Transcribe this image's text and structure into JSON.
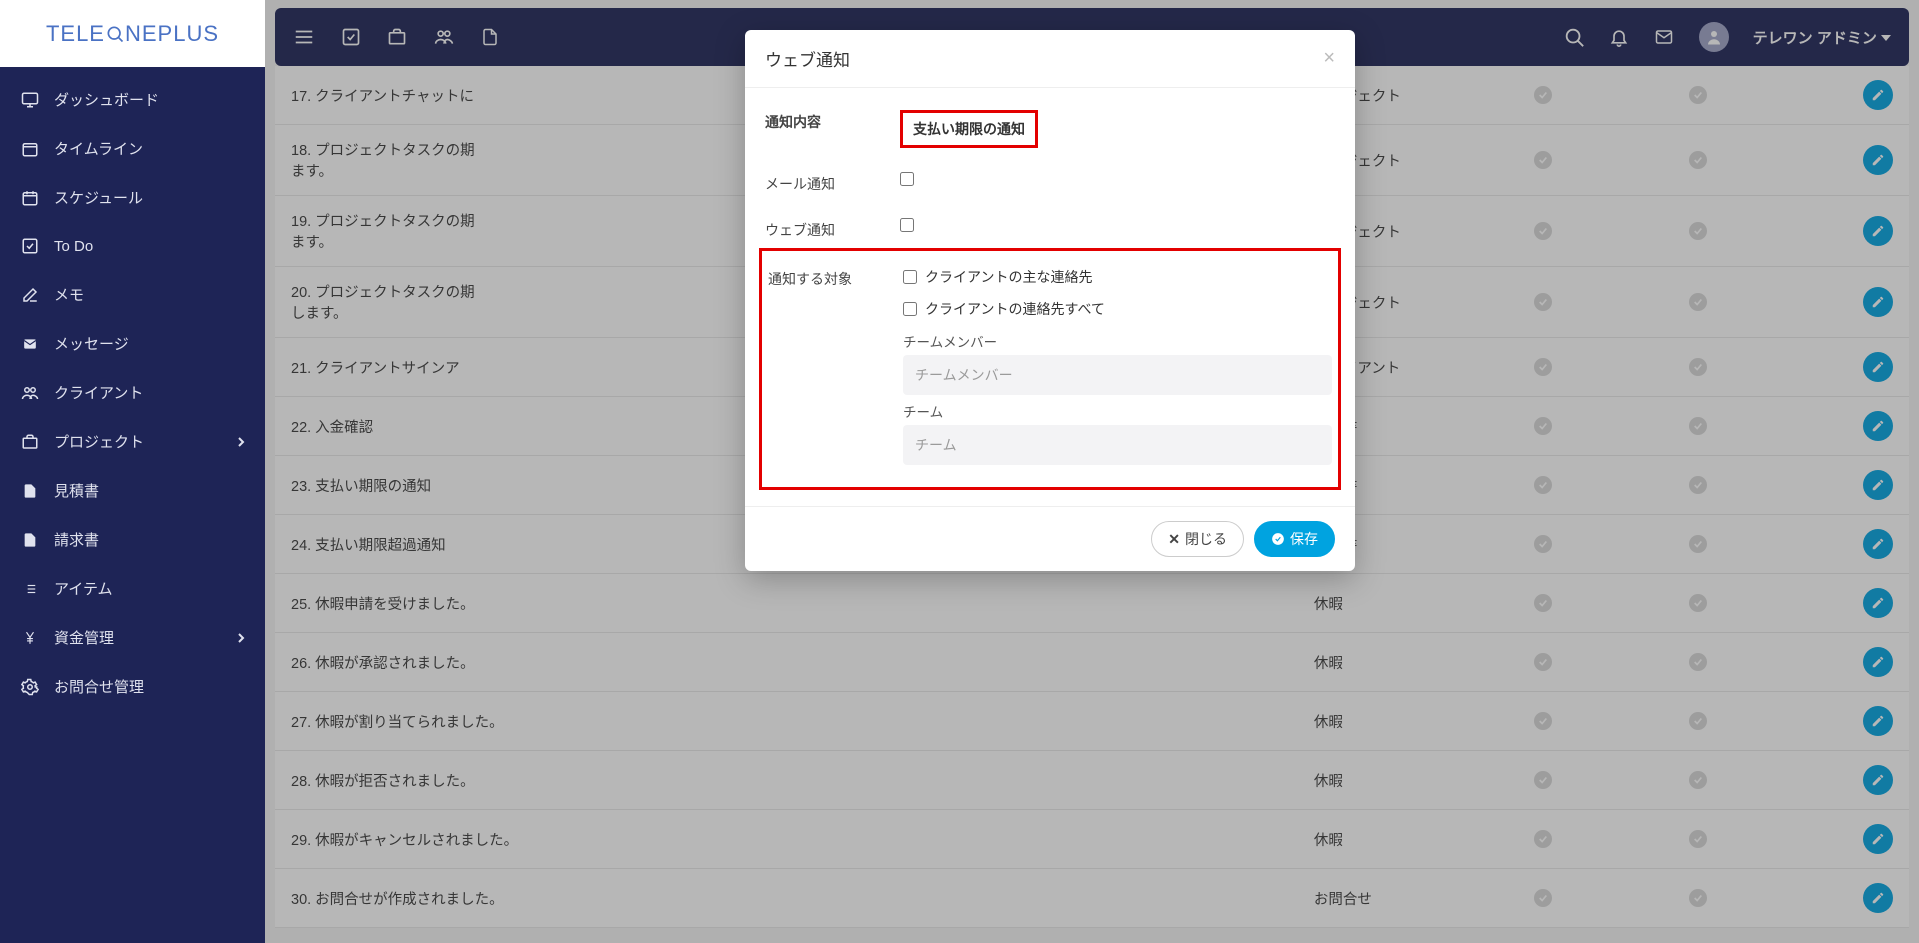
{
  "brand": "TELEONEPLUS",
  "sidebar": {
    "items": [
      {
        "label": "ダッシュボード",
        "icon": "monitor"
      },
      {
        "label": "タイムライン",
        "icon": "calendar-blank"
      },
      {
        "label": "スケジュール",
        "icon": "calendar"
      },
      {
        "label": "To Do",
        "icon": "check-square"
      },
      {
        "label": "メモ",
        "icon": "edit"
      },
      {
        "label": "メッセージ",
        "icon": "mail"
      },
      {
        "label": "クライアント",
        "icon": "users"
      },
      {
        "label": "プロジェクト",
        "icon": "briefcase",
        "expandable": true
      },
      {
        "label": "見積書",
        "icon": "file"
      },
      {
        "label": "請求書",
        "icon": "file"
      },
      {
        "label": "アイテム",
        "icon": "list"
      },
      {
        "label": "資金管理",
        "icon": "yen",
        "expandable": true
      },
      {
        "label": "お問合せ管理",
        "icon": "gear"
      }
    ]
  },
  "topbar": {
    "user": "テレワン アドミン"
  },
  "rows": [
    {
      "title": "17. クライアントチャットに",
      "category": "プロジェクト"
    },
    {
      "title": "18. プロジェクトタスクの期\nます。",
      "category": "プロジェクト"
    },
    {
      "title": "19. プロジェクトタスクの期\nます。",
      "category": "プロジェクト"
    },
    {
      "title": "20. プロジェクトタスクの期\nします。",
      "category": "プロジェクト"
    },
    {
      "title": "21. クライアントサインア",
      "category": "クライアント"
    },
    {
      "title": "22. 入金確認",
      "category": "請求書"
    },
    {
      "title": "23. 支払い期限の通知",
      "category": "請求書"
    },
    {
      "title": "24. 支払い期限超過通知",
      "category": "請求書"
    },
    {
      "title": "25. 休暇申請を受けました。",
      "category": "休暇"
    },
    {
      "title": "26. 休暇が承認されました。",
      "category": "休暇"
    },
    {
      "title": "27. 休暇が割り当てられました。",
      "category": "休暇"
    },
    {
      "title": "28. 休暇が拒否されました。",
      "category": "休暇"
    },
    {
      "title": "29. 休暇がキャンセルされました。",
      "category": "休暇"
    },
    {
      "title": "30. お問合せが作成されました。",
      "category": "お問合せ"
    }
  ],
  "modal": {
    "title": "ウェブ通知",
    "labels": {
      "content": "通知内容",
      "content_value": "支払い期限の通知",
      "mail": "メール通知",
      "web": "ウェブ通知",
      "targets": "通知する対象",
      "target_main": "クライアントの主な連絡先",
      "target_all": "クライアントの連絡先すべて",
      "team_member": "チームメンバー",
      "team_member_ph": "チームメンバー",
      "team": "チーム",
      "team_ph": "チーム"
    },
    "buttons": {
      "close": "閉じる",
      "save": "保存"
    }
  }
}
